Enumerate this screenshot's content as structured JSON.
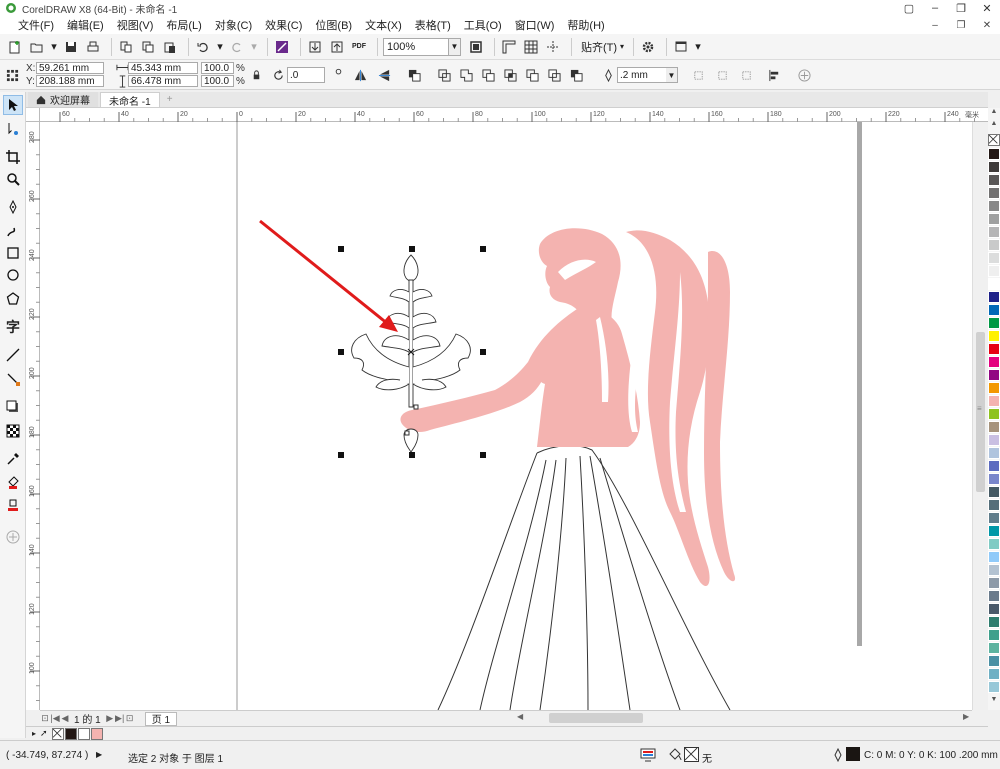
{
  "app": {
    "title": "CorelDRAW X8 (64-Bit) - 未命名 -1"
  },
  "menu": [
    "文件(F)",
    "编辑(E)",
    "视图(V)",
    "布局(L)",
    "对象(C)",
    "效果(C)",
    "位图(B)",
    "文本(X)",
    "表格(T)",
    "工具(O)",
    "窗口(W)",
    "帮助(H)"
  ],
  "standard_bar": {
    "zoom": "100%",
    "pdf_label": "PDF",
    "snap_label": "贴齐(T)"
  },
  "property_bar": {
    "x_label": "X:",
    "x_value": "59.261 mm",
    "y_label": "Y:",
    "y_value": "208.188 mm",
    "width_value": "45.343 mm",
    "height_value": "66.478 mm",
    "scale_w": "100.0",
    "scale_h": "100.0",
    "percent": "%",
    "rotation": ".0",
    "outline_width": ".2 mm"
  },
  "tabs": {
    "home": "欢迎屏幕",
    "doc": "未命名 -1",
    "add": "+"
  },
  "ruler": {
    "h_labels": [
      "60",
      "40",
      "20",
      "0",
      "20",
      "40",
      "60",
      "80",
      "100",
      "120",
      "140",
      "160",
      "180",
      "200",
      "220",
      "240"
    ],
    "h_unit": "毫米",
    "v_labels": [
      "280",
      "260",
      "240",
      "220",
      "200",
      "180",
      "160",
      "140",
      "120",
      "100"
    ]
  },
  "pagebar": {
    "page_count": "1 的 1",
    "page_tab": "页 1"
  },
  "statusbar": {
    "coords": "( -34.749, 87.274 )",
    "selection": "选定 2 对象 于 图层 1",
    "fill_none": "无",
    "cmyk": "C: 0 M: 0 Y: 0 K: 100 .200 mm"
  },
  "colors": {
    "figure_fill": "#f4b3b0",
    "arrow": "#e01b1b",
    "outline_swatch": "#1a1512"
  },
  "palette": [
    "#231815",
    "#3e3a39",
    "#595757",
    "#727171",
    "#898989",
    "#9fa0a0",
    "#b5b5b6",
    "#c9caca",
    "#dcdddd",
    "#efefef",
    "#ffffff",
    "#1d2088",
    "#0068b7",
    "#009944",
    "#fff100",
    "#e60012",
    "#e4007f",
    "#920783",
    "#f39800",
    "#f4b3b0",
    "#8fc31f",
    "#a6937c",
    "#c9bfe2",
    "#b0c4de",
    "#5c6bc0",
    "#7986cb",
    "#455a64",
    "#546e7a",
    "#607d8b",
    "#0097a7",
    "#80cbc4",
    "#90caf9",
    "#b3c2d1",
    "#8d9aa8",
    "#6a7b8c",
    "#4a5a6a",
    "#2e7d6e",
    "#3fa08c",
    "#5cb39f",
    "#4a90a4",
    "#6fb0c4",
    "#98c8d8"
  ],
  "docpalette": [
    "#ffffff",
    "#231815",
    "#ffffff",
    "#f4b3b0"
  ]
}
